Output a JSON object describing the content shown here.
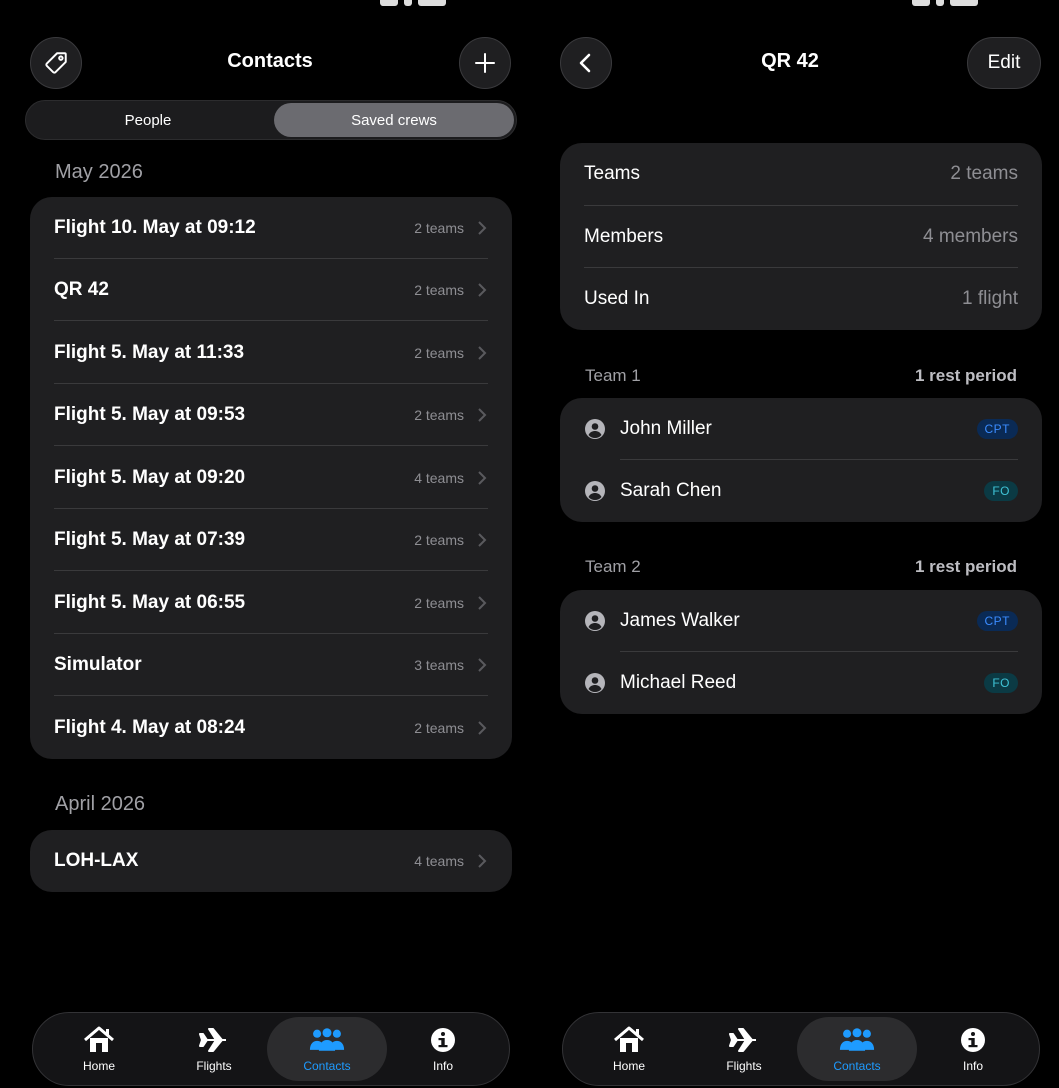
{
  "left": {
    "header": {
      "title": "Contacts"
    },
    "segments": {
      "people": "People",
      "saved": "Saved crews"
    },
    "sections": [
      {
        "title": "May 2026",
        "items": [
          {
            "title": "Flight 10. May at 09:12",
            "meta": "2 teams"
          },
          {
            "title": "QR 42",
            "meta": "2 teams"
          },
          {
            "title": "Flight 5. May at 11:33",
            "meta": "2 teams"
          },
          {
            "title": "Flight 5. May at 09:53",
            "meta": "2 teams"
          },
          {
            "title": "Flight 5. May at 09:20",
            "meta": "4 teams"
          },
          {
            "title": "Flight 5. May at 07:39",
            "meta": "2 teams"
          },
          {
            "title": "Flight 5. May at 06:55",
            "meta": "2 teams"
          },
          {
            "title": "Simulator",
            "meta": "3 teams"
          },
          {
            "title": "Flight 4. May at 08:24",
            "meta": "2 teams"
          }
        ]
      },
      {
        "title": "April 2026",
        "items": [
          {
            "title": "LOH-LAX",
            "meta": "4 teams"
          }
        ]
      }
    ]
  },
  "right": {
    "header": {
      "title": "QR 42",
      "edit": "Edit"
    },
    "summary": [
      {
        "label": "Teams",
        "value": "2 teams"
      },
      {
        "label": "Members",
        "value": "4 members"
      },
      {
        "label": "Used In",
        "value": "1 flight"
      }
    ],
    "teams": [
      {
        "name": "Team 1",
        "rest": "1 rest period",
        "members": [
          {
            "name": "John Miller",
            "role": "CPT"
          },
          {
            "name": "Sarah Chen",
            "role": "FO"
          }
        ]
      },
      {
        "name": "Team 2",
        "rest": "1 rest period",
        "members": [
          {
            "name": "James Walker",
            "role": "CPT"
          },
          {
            "name": "Michael Reed",
            "role": "FO"
          }
        ]
      }
    ]
  },
  "tabbar": {
    "home": "Home",
    "flights": "Flights",
    "contacts": "Contacts",
    "info": "Info",
    "active": "contacts"
  },
  "colors": {
    "accent": "#1e9bff",
    "card": "#1f1f21",
    "background": "#000000"
  }
}
